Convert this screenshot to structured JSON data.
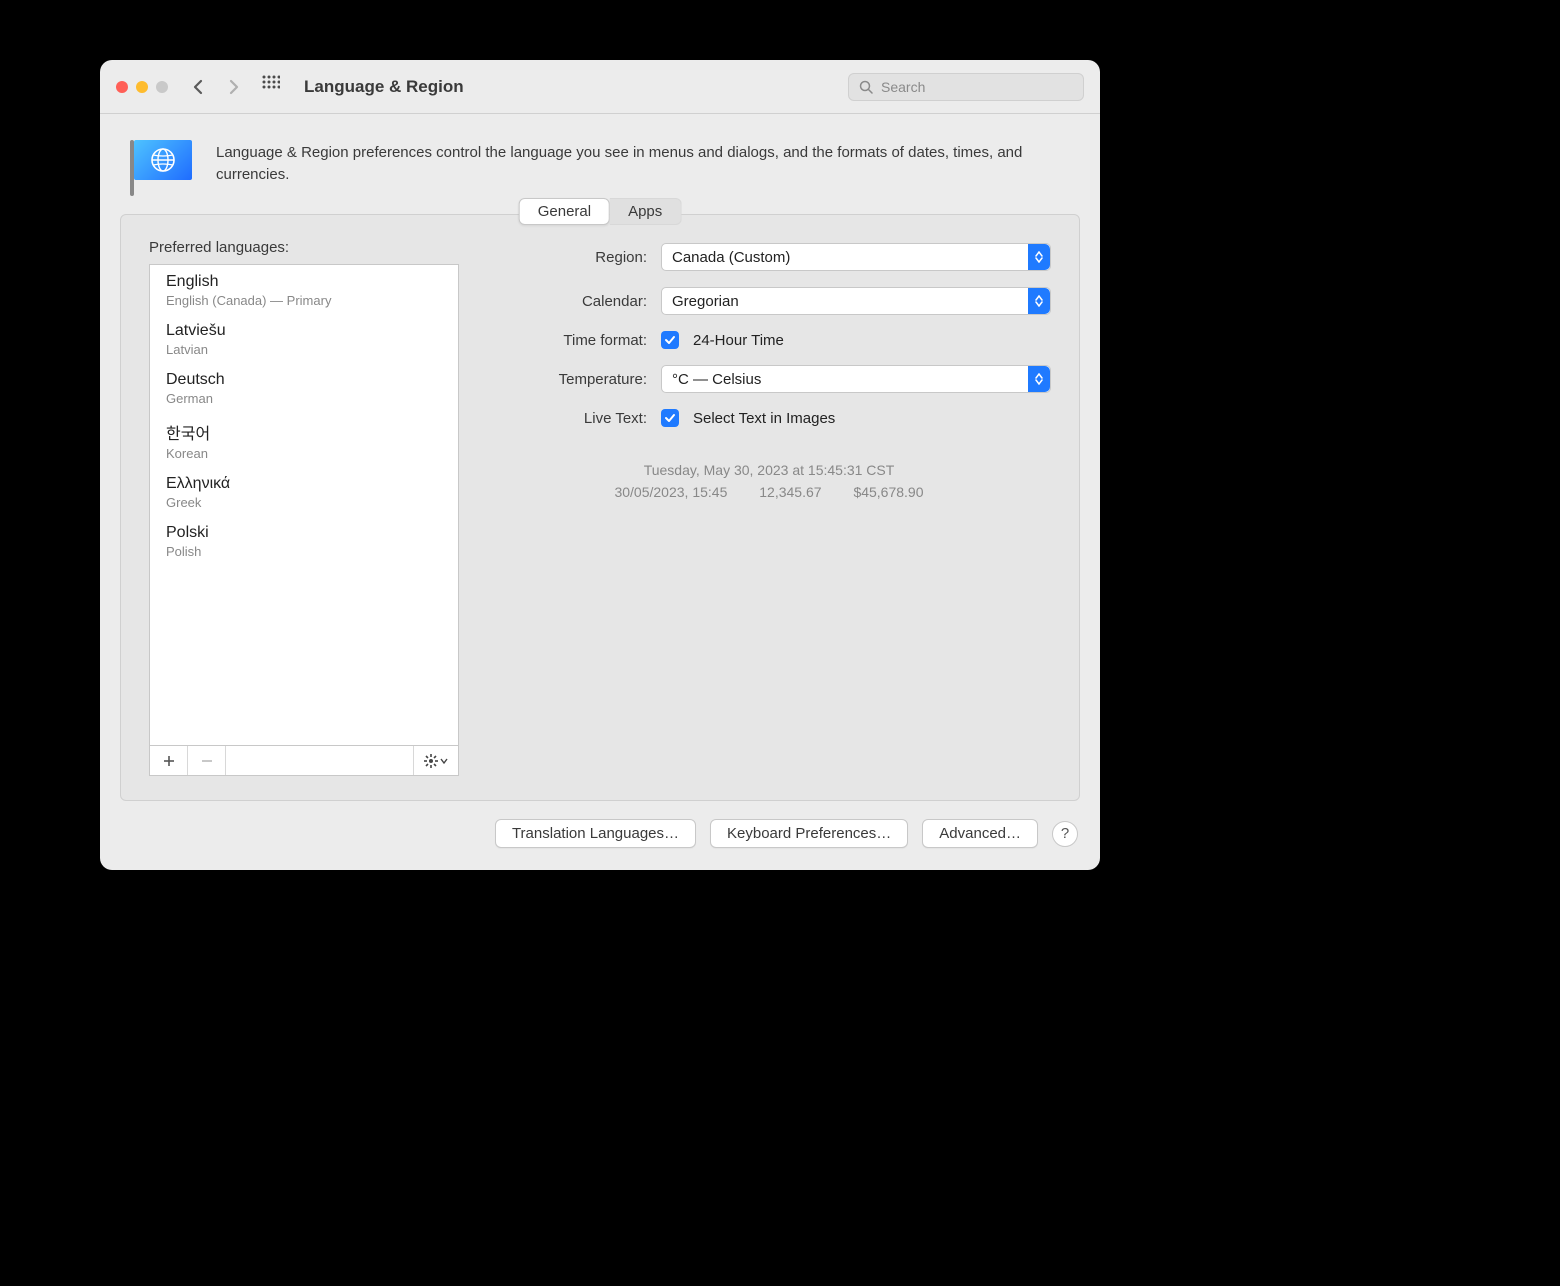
{
  "window": {
    "title": "Language & Region"
  },
  "search": {
    "placeholder": "Search"
  },
  "header": {
    "description": "Language & Region preferences control the language you see in menus and dialogs, and the formats of dates, times, and currencies."
  },
  "tabs": {
    "general": "General",
    "apps": "Apps"
  },
  "preferred_languages": {
    "label": "Preferred languages:",
    "items": [
      {
        "native": "English",
        "sub": "English (Canada) — Primary"
      },
      {
        "native": "Latviešu",
        "sub": "Latvian"
      },
      {
        "native": "Deutsch",
        "sub": "German"
      },
      {
        "native": "한국어",
        "sub": "Korean"
      },
      {
        "native": "Ελληνικά",
        "sub": "Greek"
      },
      {
        "native": "Polski",
        "sub": "Polish"
      }
    ]
  },
  "form": {
    "region_label": "Region:",
    "region_value": "Canada (Custom)",
    "calendar_label": "Calendar:",
    "calendar_value": "Gregorian",
    "timeformat_label": "Time format:",
    "timeformat_check": "24-Hour Time",
    "temperature_label": "Temperature:",
    "temperature_value": "°C — Celsius",
    "livetext_label": "Live Text:",
    "livetext_check": "Select Text in Images"
  },
  "sample": {
    "line1": "Tuesday, May 30, 2023 at 15:45:31 CST",
    "date": "30/05/2023, 15:45",
    "number": "12,345.67",
    "currency": "$45,678.90"
  },
  "buttons": {
    "translation": "Translation Languages…",
    "keyboard": "Keyboard Preferences…",
    "advanced": "Advanced…",
    "help": "?"
  }
}
